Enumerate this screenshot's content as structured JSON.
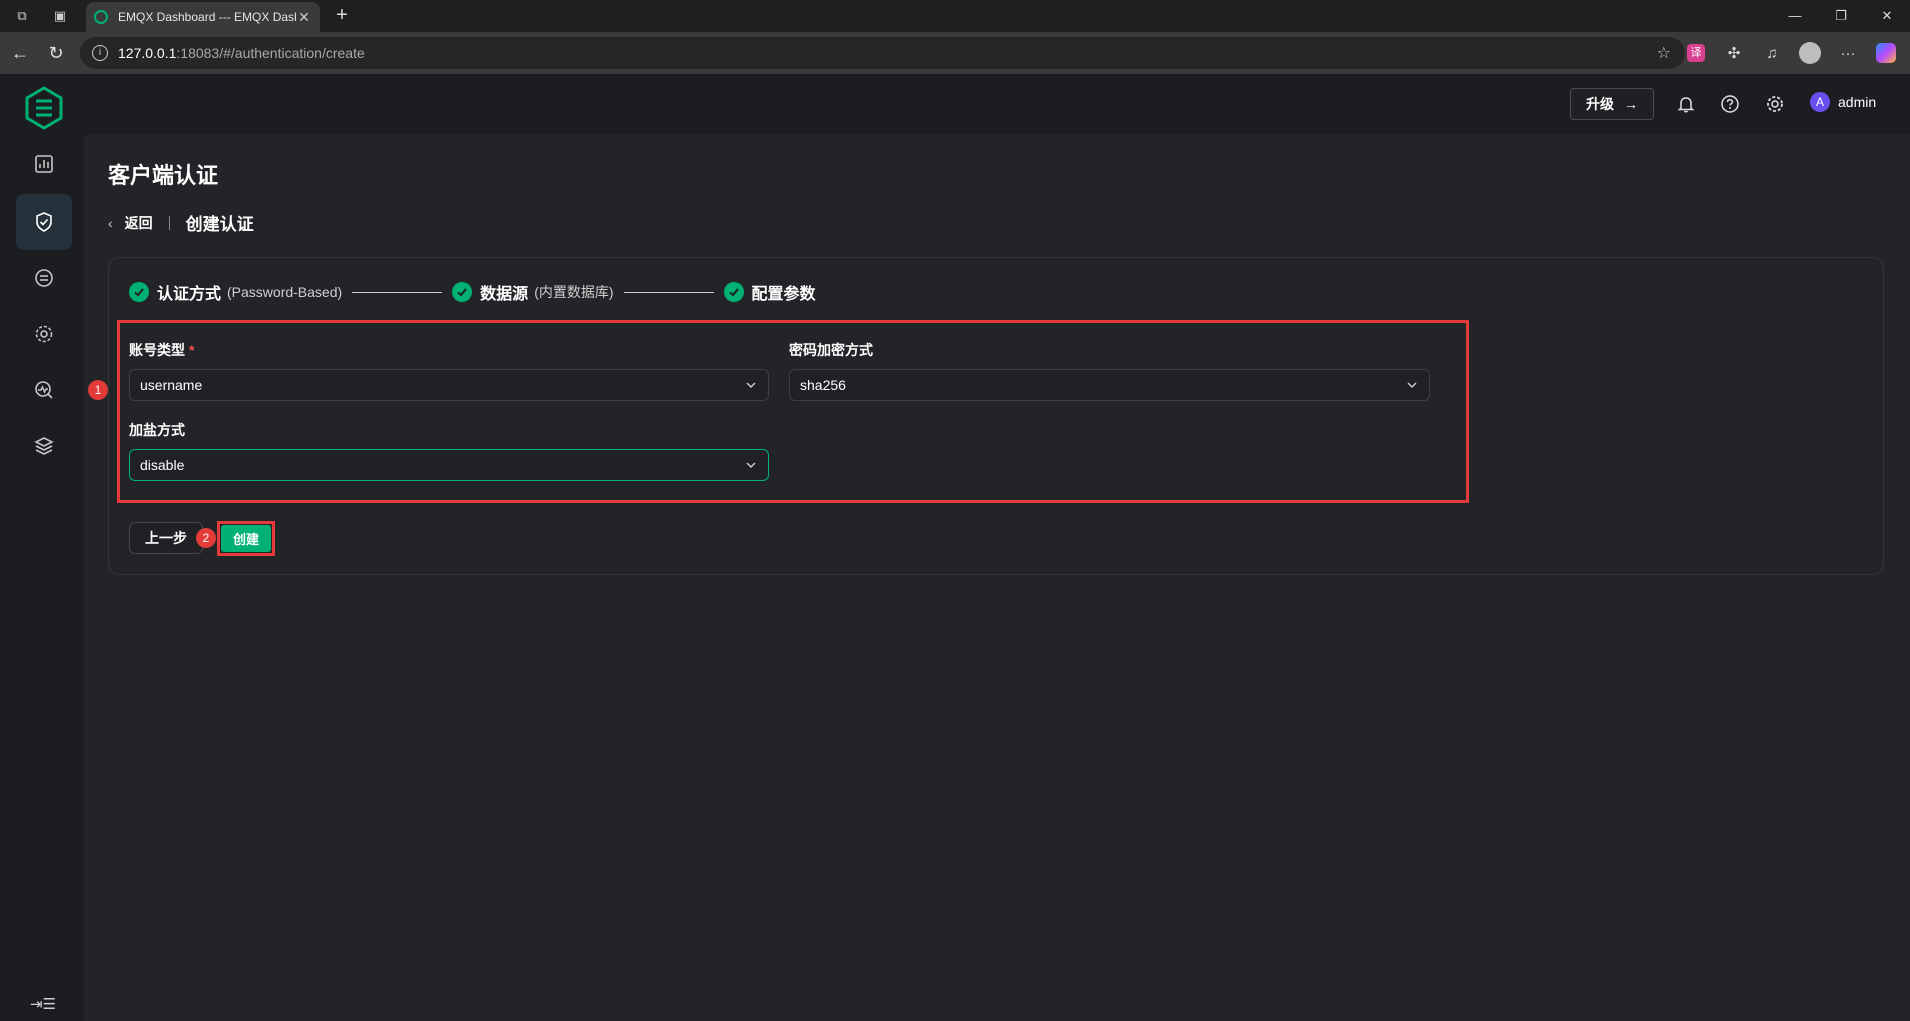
{
  "browser": {
    "tab_title": "EMQX Dashboard --- EMQX Dash",
    "url_host": "127.0.0.1",
    "url_rest": ":18083/#/authentication/create"
  },
  "header": {
    "upgrade_label": "升级",
    "user_initial": "A",
    "user_name": "admin"
  },
  "page": {
    "title": "客户端认证",
    "back_label": "返回",
    "crumb_title": "创建认证"
  },
  "steps": [
    {
      "name": "认证方式",
      "sub": "(Password-Based)"
    },
    {
      "name": "数据源",
      "sub": "(内置数据库)"
    },
    {
      "name": "配置参数",
      "sub": ""
    }
  ],
  "form": {
    "account_type": {
      "label": "账号类型",
      "required_mark": "*",
      "value": "username"
    },
    "password_hash": {
      "label": "密码加密方式",
      "value": "sha256"
    },
    "salt_position": {
      "label": "加盐方式",
      "value": "disable"
    }
  },
  "actions": {
    "prev_label": "上一步",
    "create_label": "创建"
  },
  "annotations": {
    "badge_1": "1",
    "badge_2": "2"
  },
  "colors": {
    "accent": "#00b173",
    "highlight": "#e33a3a"
  }
}
